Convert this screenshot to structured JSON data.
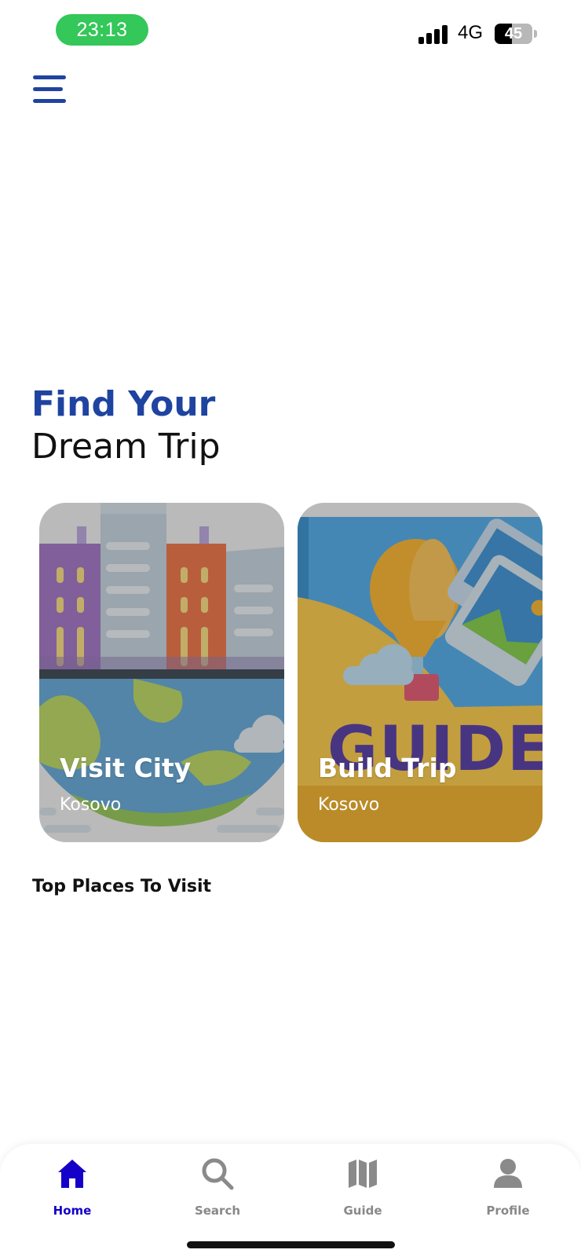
{
  "status_bar": {
    "time": "23:13",
    "network": "4G",
    "battery_level": 45
  },
  "header": {
    "menu_icon": "hamburger-menu-icon"
  },
  "hero": {
    "line1": "Find Your",
    "line2": "Dream Trip"
  },
  "cards": [
    {
      "title": "Visit City",
      "subtitle": "Kosovo"
    },
    {
      "title": "Build Trip",
      "subtitle": "Kosovo"
    }
  ],
  "section": {
    "title": "Top Places To Visit"
  },
  "bottom_nav": {
    "items": [
      {
        "label": "Home",
        "icon": "home-icon",
        "active": true
      },
      {
        "label": "Search",
        "icon": "search-icon",
        "active": false
      },
      {
        "label": "Guide",
        "icon": "map-icon",
        "active": false
      },
      {
        "label": "Profile",
        "icon": "profile-icon",
        "active": false
      }
    ]
  },
  "colors": {
    "brand_blue": "#1f43a0",
    "active_nav": "#1400c8",
    "status_green": "#34c759"
  }
}
